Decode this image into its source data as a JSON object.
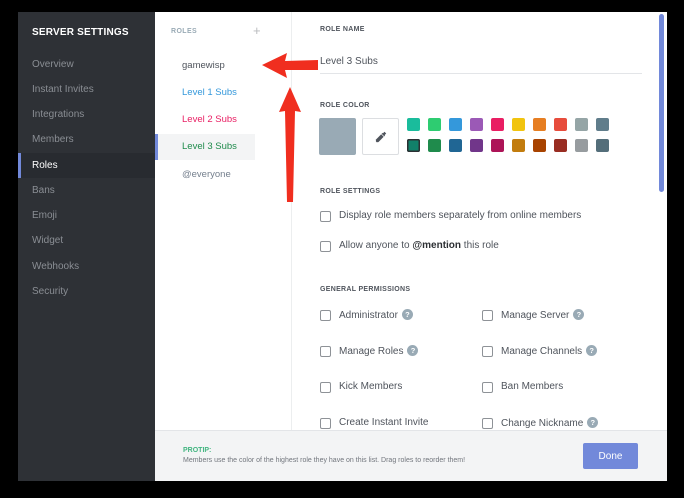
{
  "sidebar": {
    "title": "SERVER SETTINGS",
    "items": [
      {
        "label": "Overview",
        "active": false
      },
      {
        "label": "Instant Invites",
        "active": false
      },
      {
        "label": "Integrations",
        "active": false
      },
      {
        "label": "Members",
        "active": false
      },
      {
        "label": "Roles",
        "active": true
      },
      {
        "label": "Bans",
        "active": false
      },
      {
        "label": "Emoji",
        "active": false
      },
      {
        "label": "Widget",
        "active": false
      },
      {
        "label": "Webhooks",
        "active": false
      },
      {
        "label": "Security",
        "active": false
      }
    ]
  },
  "roles_panel": {
    "header": "ROLES",
    "add_icon": "plus-icon",
    "roles": [
      {
        "name": "gamewisp",
        "color": "#4f545c",
        "selected": false
      },
      {
        "name": "Level 1 Subs",
        "color": "#3498db",
        "selected": false
      },
      {
        "name": "Level 2 Subs",
        "color": "#e91e63",
        "selected": false
      },
      {
        "name": "Level 3 Subs",
        "color": "#1f8b4c",
        "selected": true
      },
      {
        "name": "@everyone",
        "color": "#747f8d",
        "selected": false
      }
    ]
  },
  "role_name": {
    "header": "ROLE NAME",
    "value": "Level 3 Subs"
  },
  "role_color": {
    "header": "ROLE COLOR",
    "default_color": "#99aab5",
    "picker_icon": "eyedropper-icon",
    "swatches_row1": [
      "#1abc9c",
      "#2ecc71",
      "#3498db",
      "#9b59b6",
      "#e91e63",
      "#f1c40f",
      "#e67e22",
      "#e74c3c",
      "#95a5a6",
      "#607d8b"
    ],
    "swatches_row2": [
      "#11806a",
      "#1f8b4c",
      "#206694",
      "#71368a",
      "#ad1457",
      "#c27c0e",
      "#a84300",
      "#992d22",
      "#979c9f",
      "#546e7a"
    ],
    "selected_row": 2,
    "selected_index": 0
  },
  "role_settings": {
    "header": "ROLE SETTINGS",
    "display_separately": "Display role members separately from online members",
    "mention_prefix": "Allow anyone to ",
    "mention_bold": "@mention",
    "mention_suffix": " this role"
  },
  "general_permissions": {
    "header": "GENERAL PERMISSIONS",
    "left": [
      {
        "label": "Administrator",
        "help": true
      },
      {
        "label": "Manage Roles",
        "help": true
      },
      {
        "label": "Kick Members",
        "help": false
      },
      {
        "label": "Create Instant Invite",
        "help": false
      }
    ],
    "right": [
      {
        "label": "Manage Server",
        "help": true
      },
      {
        "label": "Manage Channels",
        "help": true
      },
      {
        "label": "Ban Members",
        "help": false
      },
      {
        "label": "Change Nickname",
        "help": true
      }
    ],
    "help_glyph": "?"
  },
  "footer": {
    "protip_label": "PROTIP:",
    "protip_text": "Members use the color of the highest role they have on this list. Drag roles to reorder them!",
    "done_label": "Done"
  },
  "colors": {
    "accent": "#7289da",
    "annotation_arrow": "#f02e1f"
  }
}
